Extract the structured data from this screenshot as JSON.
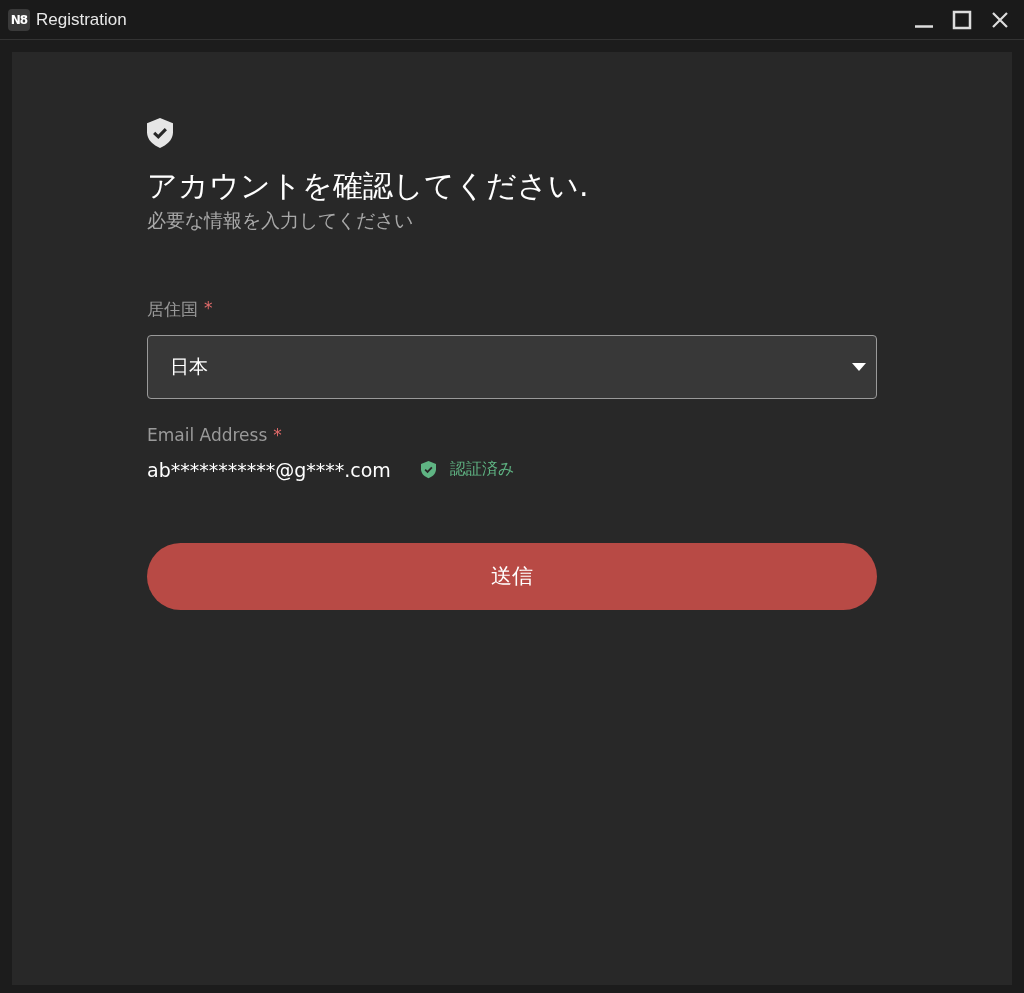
{
  "window": {
    "logo": "N8",
    "title": "Registration"
  },
  "form": {
    "heading": "アカウントを確認してください.",
    "subheading": "必要な情報を入力してください",
    "fields": [
      {
        "kind": "select",
        "label": "居住国",
        "required_mark": "*",
        "value": "日本"
      },
      {
        "kind": "verified",
        "label": "Email Address",
        "required_mark": "*",
        "value": "ab***********@g****.com",
        "status": "認証済み"
      }
    ],
    "submit": "送信"
  }
}
